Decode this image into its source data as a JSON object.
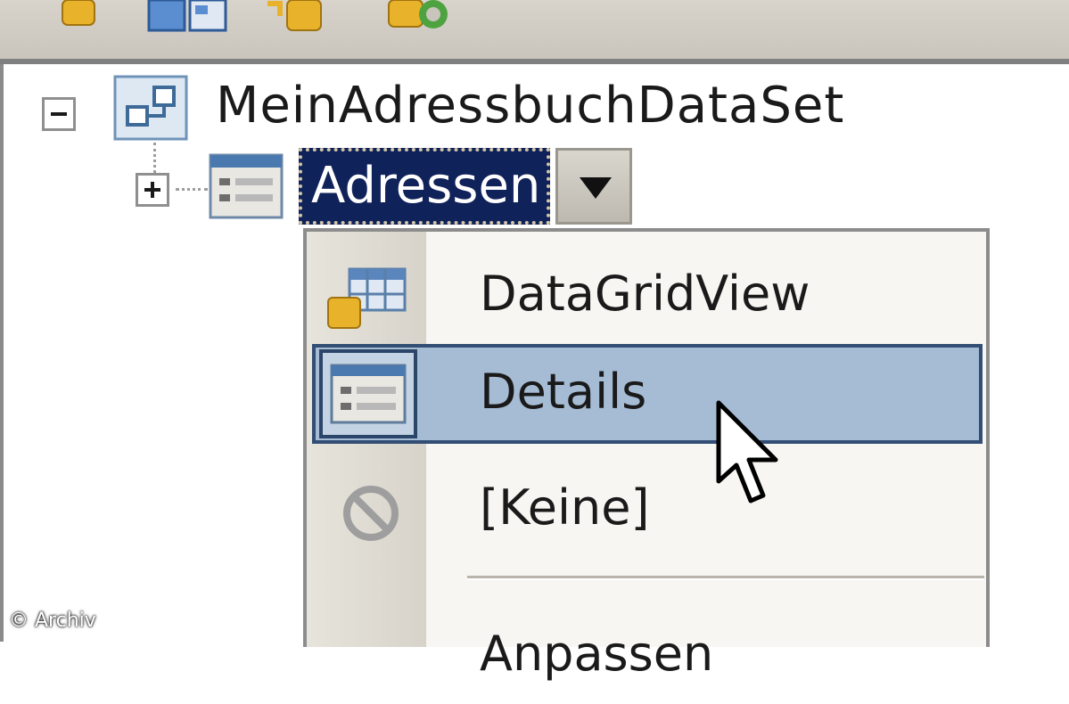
{
  "tree": {
    "dataset_label": "MeinAdressbuchDataSet",
    "table_label": "Adressen"
  },
  "menu": {
    "items": [
      {
        "label": "DataGridView",
        "icon": "datagridview-icon"
      },
      {
        "label": "Details",
        "icon": "details-form-icon",
        "highlighted": true
      },
      {
        "label": "[Keine]",
        "icon": "none-icon"
      },
      {
        "label": "Anpassen",
        "icon": ""
      }
    ]
  },
  "watermark": "© Archiv",
  "colors": {
    "selection": "#10225a",
    "menu_highlight": "#a6bcd5",
    "menu_highlight_border": "#324e74"
  }
}
